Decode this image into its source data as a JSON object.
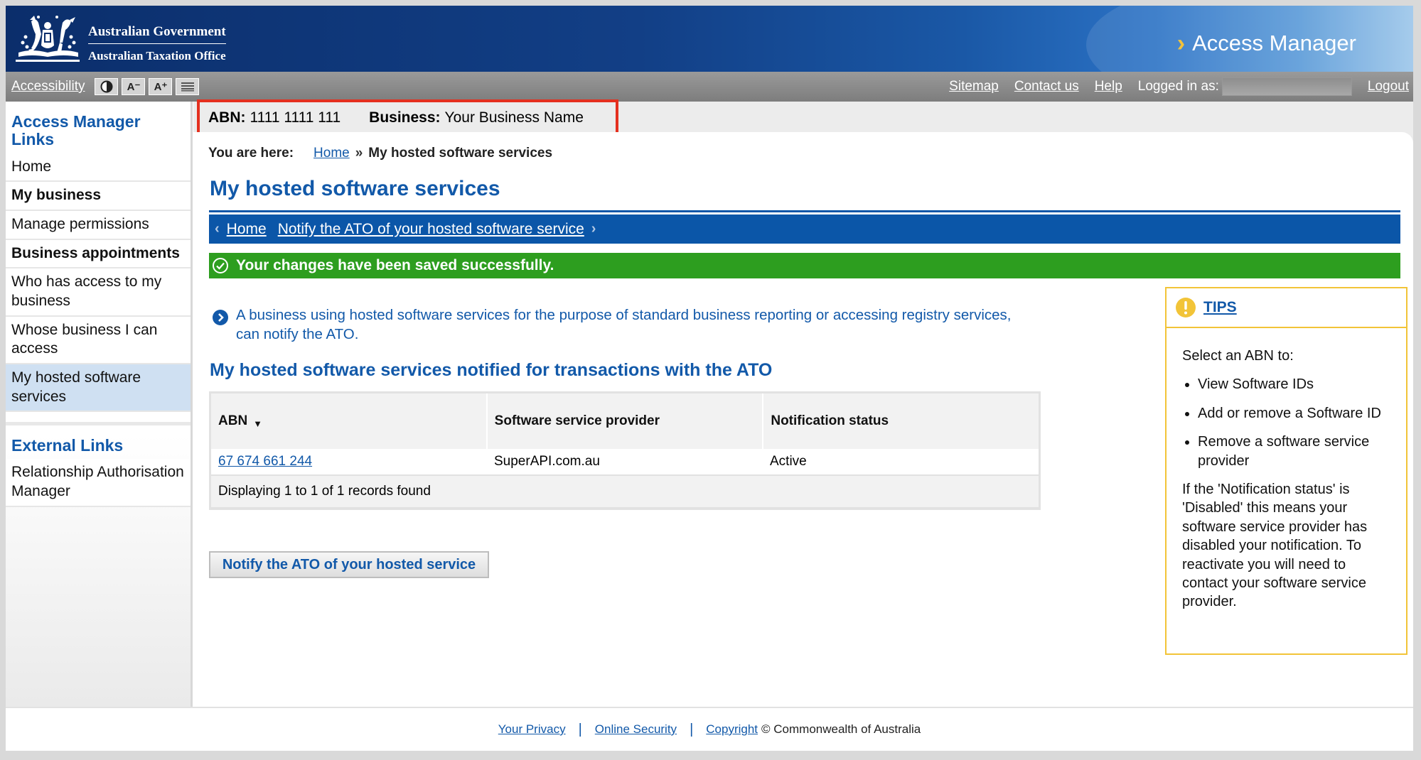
{
  "header": {
    "gov_title": "Australian Government",
    "gov_office": "Australian Taxation Office",
    "app_title": "Access Manager"
  },
  "toolbar": {
    "accessibility": "Accessibility",
    "contrast_icon": "contrast-icon",
    "font_decrease": "A⁻",
    "font_increase": "A⁺",
    "print_icon": "text-only-icon",
    "sitemap": "Sitemap",
    "contact": "Contact us",
    "help": "Help",
    "logged_in": "Logged in as:",
    "logout": "Logout"
  },
  "business": {
    "abn_label": "ABN:",
    "abn_value": "1111 1111 111",
    "business_label": "Business:",
    "business_value": "Your Business Name"
  },
  "sidebar": {
    "heading": "Access Manager Links",
    "items": [
      {
        "label": "Home"
      },
      {
        "label": "My business"
      },
      {
        "label": "Manage permissions"
      },
      {
        "label": "Business appointments"
      },
      {
        "label": "Who has access to my business"
      },
      {
        "label": "Whose business I can access"
      },
      {
        "label": "My hosted software services"
      }
    ],
    "external_heading": "External Links",
    "external_items": [
      {
        "label": "Relationship Authorisation Manager"
      }
    ]
  },
  "breadcrumb": {
    "label": "You are here:",
    "home": "Home",
    "sep": "»",
    "current": "My hosted software services"
  },
  "page": {
    "title": "My hosted software services",
    "nav_home": "Home",
    "nav_notify": "Notify the ATO of your hosted software service",
    "success": "Your changes have been saved successfully.",
    "info": "A business using hosted software services for the purpose of standard business reporting or accessing registry services, can notify the ATO.",
    "section_title": "My hosted software services notified for transactions with the ATO",
    "notify_button": "Notify the ATO of your hosted service"
  },
  "table": {
    "headers": [
      "ABN",
      "Software service provider",
      "Notification status"
    ],
    "rows": [
      {
        "abn": "67 674 661 244",
        "provider": "SuperAPI.com.au",
        "status": "Active"
      }
    ],
    "footer": "Displaying 1 to 1 of 1 records found"
  },
  "tips": {
    "title": "TIPS",
    "intro": "Select an ABN to:",
    "items": [
      "View Software IDs",
      "Add or remove a Software ID",
      "Remove a software service provider"
    ],
    "note": "If the 'Notification status' is 'Disabled' this means your software service provider has disabled your notification. To reactivate you will need to contact your software service provider."
  },
  "footer": {
    "privacy": "Your Privacy",
    "security": "Online Security",
    "copyright": "Copyright",
    "copyright_text": "© Commonwealth of Australia"
  },
  "colors": {
    "header_navy": "#0b2e6b",
    "link_blue": "#1259a9",
    "nav_blue": "#0b56a8",
    "success_green": "#2d9e1f",
    "highlight_red": "#e4301f",
    "tips_yellow": "#f2c438"
  }
}
